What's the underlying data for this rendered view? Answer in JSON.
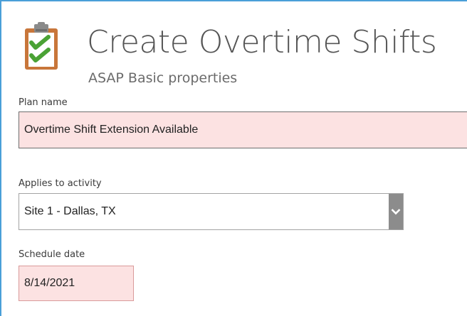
{
  "header": {
    "title": "Create Overtime Shifts",
    "subtitle": "ASAP Basic properties",
    "icon": "clipboard-checklist-icon"
  },
  "form": {
    "plan_name": {
      "label": "Plan name",
      "value": "Overtime Shift Extension Available"
    },
    "applies_to_activity": {
      "label": "Applies to activity",
      "value": "Site 1 - Dallas, TX"
    },
    "schedule_date": {
      "label": "Schedule date",
      "value": "8/14/2021"
    }
  },
  "colors": {
    "accent_border": "#4a9fd8",
    "required_field_bg": "#fce2e2",
    "checkmark_green": "#4aa235",
    "clipboard_brown": "#c8763a"
  }
}
